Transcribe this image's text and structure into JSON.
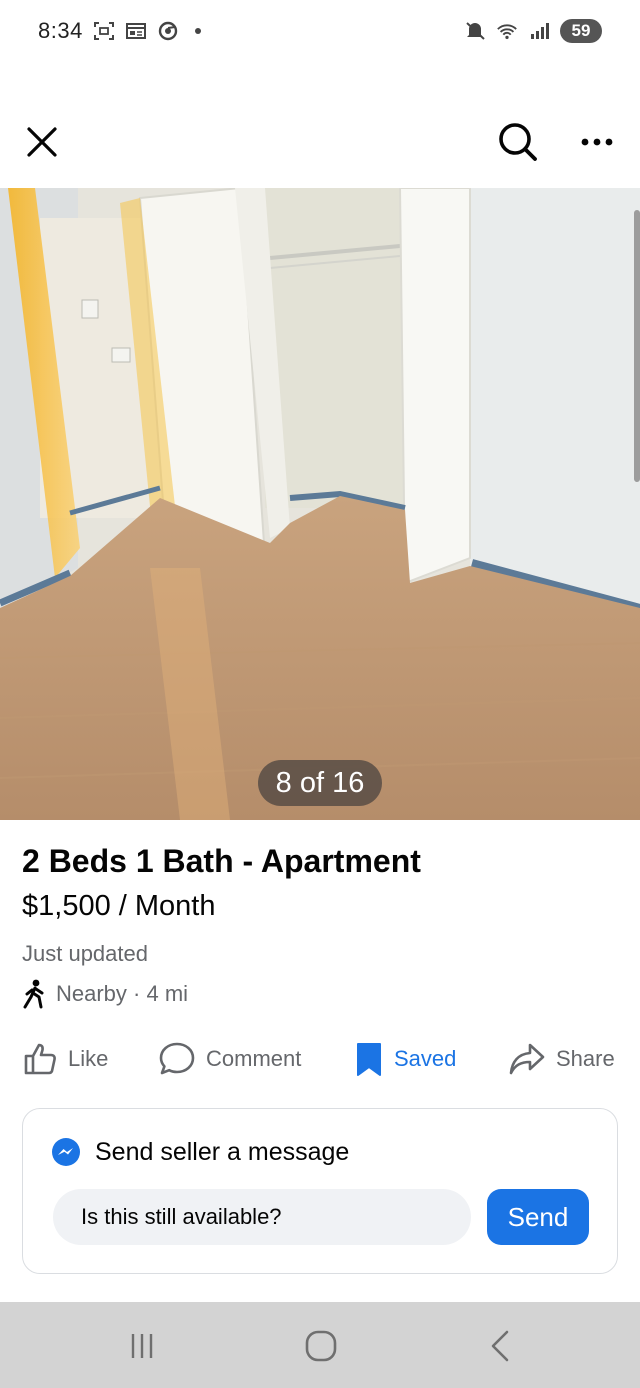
{
  "status_bar": {
    "time": "8:34",
    "battery": "59",
    "left_icons": [
      "screenshot-icon",
      "news-icon",
      "chrome-icon",
      "dot"
    ],
    "right_icons": [
      "mute-icon",
      "wifi-icon",
      "signal-icon",
      "battery-icon"
    ]
  },
  "toolbar": {
    "close_icon": "close-icon",
    "search_icon": "search-icon",
    "more_icon": "more-icon"
  },
  "photo": {
    "counter": "8 of 16",
    "description_icon": "apartment-room-photo"
  },
  "listing": {
    "title": "2 Beds 1 Bath - Apartment",
    "price": "$1,500 / Month",
    "updated": "Just updated",
    "distance": "Nearby · 4 mi"
  },
  "actions": {
    "like": "Like",
    "comment": "Comment",
    "saved": "Saved",
    "share": "Share"
  },
  "message": {
    "title": "Send seller a message",
    "input_value": "Is this still available?",
    "send_label": "Send"
  },
  "colors": {
    "accent": "#1b74e4",
    "secondary_text": "#65676b",
    "nav_bar": "#d3d3d3"
  }
}
